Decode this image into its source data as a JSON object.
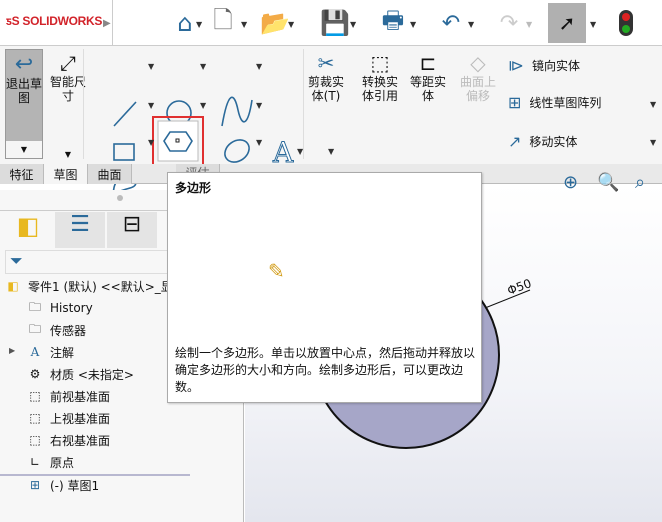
{
  "app": {
    "logo": "SOLIDWORKS"
  },
  "ribbon": {
    "exit_sketch": "退出草图",
    "smart_dim": "智能尺寸",
    "trim": "剪裁实体(T)",
    "convert": "转换实体引用",
    "offset": "等距实体",
    "surface_offset": "曲面上偏移",
    "mirror": "镜向实体",
    "linear_pattern": "线性草图阵列",
    "move": "移动实体"
  },
  "tabs": [
    {
      "label": "特征"
    },
    {
      "label": "草图"
    },
    {
      "label": "曲面"
    },
    {
      "label": "评估"
    }
  ],
  "tooltip": {
    "title": "多边形",
    "body": "绘制一个多边形。单击以放置中心点，然后拖动并释放以确定多边形的大小和方向。绘制多边形后，可以更改边数。"
  },
  "tree": {
    "root": "零件1 (默认) <<默认>_显",
    "items": [
      {
        "label": "History"
      },
      {
        "label": "传感器"
      },
      {
        "label": "注解"
      },
      {
        "label": "材质 <未指定>"
      },
      {
        "label": "前视基准面"
      },
      {
        "label": "上视基准面"
      },
      {
        "label": "右视基准面"
      },
      {
        "label": "原点"
      },
      {
        "label": "(-) 草图1"
      }
    ]
  },
  "viewport": {
    "dimension": "Φ50"
  },
  "colors": {
    "accent": "#2b6a9a",
    "highlight": "#e03030",
    "circle_fill": "#a6a6c8"
  }
}
